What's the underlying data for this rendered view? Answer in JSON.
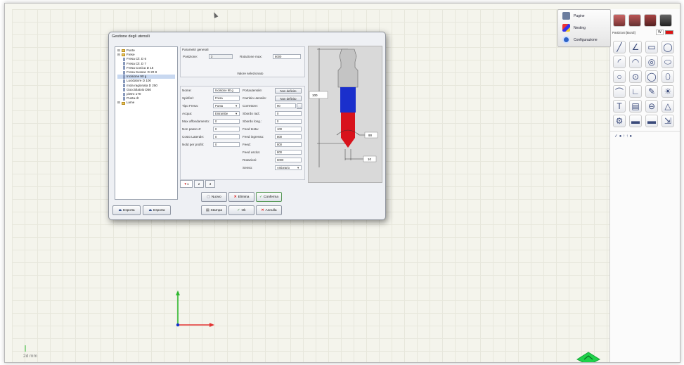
{
  "config_panel": {
    "items": [
      {
        "label": "Pagine",
        "icon": "pages-icon"
      },
      {
        "label": "Nesting",
        "icon": "nesting-icon"
      },
      {
        "label": "Configurazione",
        "icon": "gear-icon"
      }
    ]
  },
  "right_panel": {
    "top_icons": [
      "layer-icon",
      "layer-icon",
      "layer-icon",
      "layer-icon"
    ],
    "layer_select": "Partizioni [Bordi]",
    "layer_dropdown_text": "W",
    "layer_color": "#dd1111",
    "draw_tools": [
      "line-icon",
      "polyline-icon",
      "rectangle-icon",
      "circle-icon",
      "arc-icon",
      "arc-3p-icon",
      "circle-2p-icon",
      "ellipse-icon",
      "circle-ring-icon",
      "circle-center-icon",
      "circle-small-icon",
      "oval-icon",
      "fillet-icon",
      "angle-icon",
      "pencil-icon",
      "bulb-icon",
      "text-icon",
      "hatch-icon",
      "target-icon",
      "dimension-icon",
      "gear-shape-icon",
      "car-icon",
      "bus-icon",
      "import-icon"
    ],
    "small_tools_text": "✓ ● ↑ ↑ ●"
  },
  "dialog": {
    "title": "Gestione degli utensili",
    "tree": [
      {
        "label": "Punte",
        "level": 0,
        "type": "folder"
      },
      {
        "label": "Frese",
        "level": 0,
        "type": "folder"
      },
      {
        "label": "Fresa Cil. D 6",
        "level": 1,
        "type": "tool"
      },
      {
        "label": "Fresa Cil. D 7",
        "level": 1,
        "type": "tool"
      },
      {
        "label": "Fresa Conica D 16",
        "level": 1,
        "type": "tool"
      },
      {
        "label": "Fresa Svasat. D 20 8",
        "level": 1,
        "type": "tool"
      },
      {
        "label": "Incisione 90 g",
        "level": 1,
        "type": "tool",
        "selected": true
      },
      {
        "label": "Lucidatore D 100",
        "level": 1,
        "type": "tool"
      },
      {
        "label": "mola ragionata D 250",
        "level": 1,
        "type": "tool"
      },
      {
        "label": "Gocciolatoio D50",
        "level": 1,
        "type": "tool"
      },
      {
        "label": "pietro 170",
        "level": 1,
        "type": "tool"
      },
      {
        "label": "Punta dt",
        "level": 1,
        "type": "tool"
      },
      {
        "label": "Lame",
        "level": 0,
        "type": "folder"
      }
    ],
    "general": {
      "title": "Parametri generali",
      "position_label": "Posizione:",
      "position_value": "3",
      "rotation_max_label": "Rotazione max:",
      "rotation_max_value": "8000",
      "selected_value_label": "Valore selezionato"
    },
    "fields_left": [
      {
        "label": "Nome:",
        "value": "Incisione 90 g"
      },
      {
        "label": "Spiriferi:",
        "value": "Fresa"
      },
      {
        "label": "Tipo Fresa:",
        "value": "Punta",
        "dropdown": true
      },
      {
        "label": "Acqua:",
        "value": "Entrambe",
        "dropdown": true
      },
      {
        "label": "Max affondamento:",
        "value": "0"
      },
      {
        "label": "Non passo Z:",
        "value": "0"
      },
      {
        "label": "Costo Laterale:",
        "value": "0"
      },
      {
        "label": "Nold per profili:",
        "value": "0"
      }
    ],
    "fields_right": [
      {
        "label": "Portautensile:",
        "value": "Non definito",
        "button": true
      },
      {
        "label": "Cambio utensile:",
        "value": "Non definito",
        "button": true
      },
      {
        "label": "Correttore:",
        "value": "90",
        "extra": "..."
      },
      {
        "label": "Sbordo rad.:",
        "value": "0"
      },
      {
        "label": "Sbordo long.:",
        "value": "0"
      },
      {
        "label": "Feed testa:",
        "value": "100"
      },
      {
        "label": "Feed ingresso:",
        "value": "800"
      },
      {
        "label": "Feed:",
        "value": "800"
      },
      {
        "label": "Feed uscita:",
        "value": "800"
      },
      {
        "label": "Rotazioni:",
        "value": "6000"
      },
      {
        "label": "Senso:",
        "value": "Antiorario",
        "dropdown": true
      }
    ],
    "dims": {
      "height": "100",
      "angle": "90",
      "diameter": "10"
    },
    "tabs": [
      "1",
      "2",
      "3"
    ],
    "action_buttons": [
      "Nuovo",
      "Elimina",
      "Conferma"
    ],
    "export_buttons": [
      "Esporta",
      "Esporta"
    ],
    "bottom_buttons": [
      "Stampa",
      "Ok",
      "Annulla"
    ]
  },
  "axis_colors": {
    "y": "#2fb82f",
    "x": "#e33333",
    "origin": "#1133cc"
  },
  "status": {
    "text": "2d mm"
  }
}
